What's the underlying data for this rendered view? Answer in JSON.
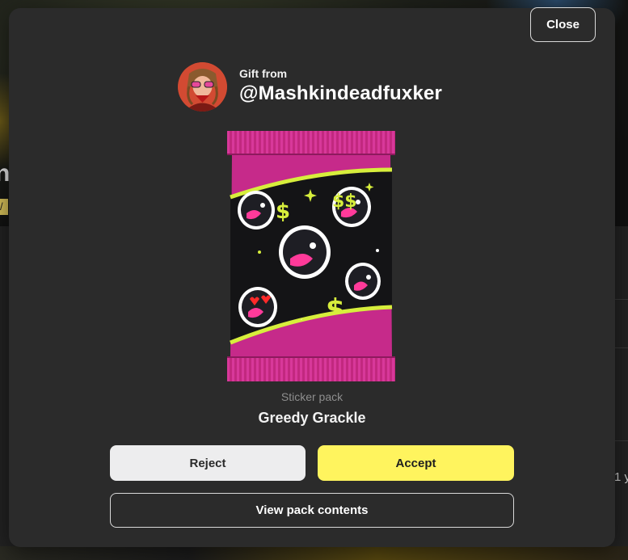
{
  "background": {
    "title_fragment": "n",
    "chip_fragment": "/",
    "side_text_fragment": "1 y"
  },
  "modal": {
    "close_label": "Close",
    "gift_from_label": "Gift from",
    "sender_username": "@Mashkindeadfuxker",
    "pack_type": "Sticker pack",
    "pack_name": "Greedy Grackle",
    "reject_label": "Reject",
    "accept_label": "Accept",
    "view_contents_label": "View pack contents"
  },
  "colors": {
    "modal_bg": "#2b2b2b",
    "accent_yellow": "#fff45e",
    "reject_bg": "#ededee",
    "pack_magenta": "#c92a8c",
    "pack_lime": "#d7ee3c"
  },
  "icons": {
    "avatar": "user-avatar",
    "pack": "sticker-pack-artwork"
  }
}
